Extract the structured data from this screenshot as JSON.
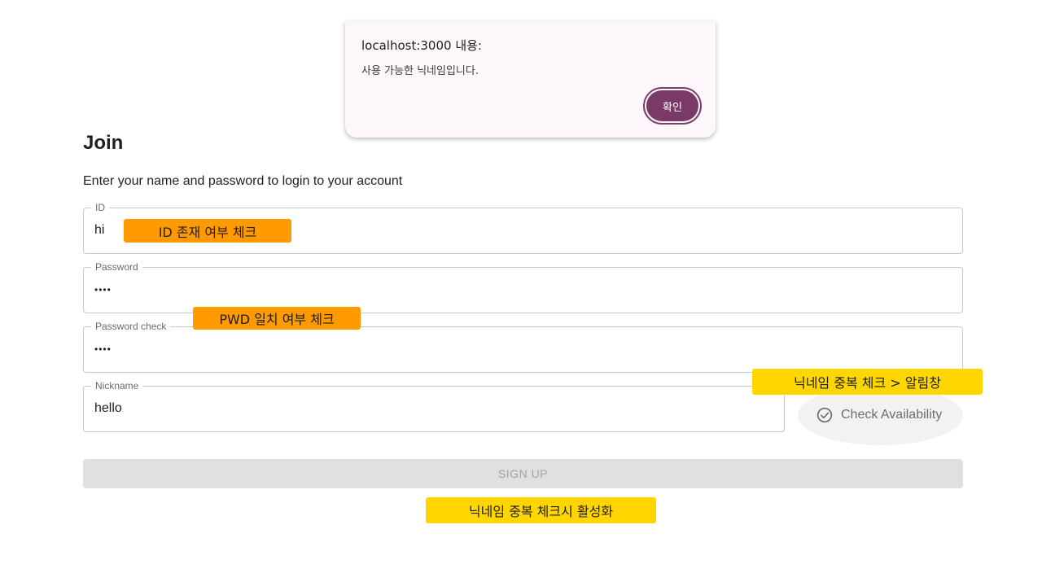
{
  "dialog": {
    "title": "localhost:3000 내용:",
    "message": "사용 가능한 닉네임입니다.",
    "ok_label": "확인"
  },
  "form": {
    "title": "Join",
    "subtitle": "Enter your name and password to login to your account",
    "fields": {
      "id": {
        "label": "ID",
        "value": "hi"
      },
      "password": {
        "label": "Password",
        "value": "••••"
      },
      "password_check": {
        "label": "Password check",
        "value": "••••"
      },
      "nickname": {
        "label": "Nickname",
        "value": "hello"
      }
    },
    "check_availability_label": "Check Availability",
    "check_icon": "check-circle-icon",
    "signup_label": "SIGN UP"
  },
  "annotations": {
    "id_check": "ID 존재 여부 체크",
    "pwd_check": "PWD 일치 여부 체크",
    "nickname_alert": "닉네임 중복 체크 > 알림창",
    "signup_enable": "닉네임 중복 체크시 활성화"
  },
  "colors": {
    "dialog_bg": "#fdf7fc",
    "ok_button": "#7a3a67",
    "note_orange": "#ff9a00",
    "note_yellow": "#ffd600",
    "signup_disabled": "#e0e0e0"
  }
}
